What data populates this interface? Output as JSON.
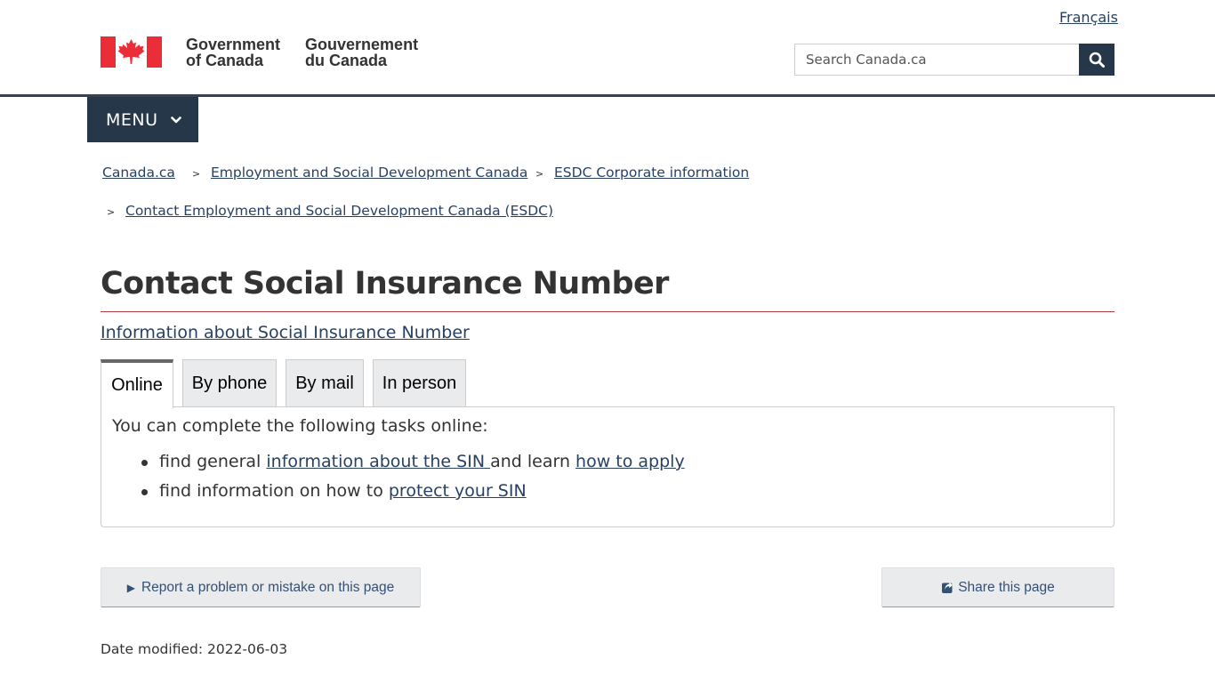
{
  "header": {
    "language_toggle": "Français",
    "gov_en_line1": "Government",
    "gov_en_line2": "of Canada",
    "gov_fr_line1": "Gouvernement",
    "gov_fr_line2": "du Canada",
    "search_placeholder": "Search Canada.ca",
    "search_icon": "search-icon",
    "brand_colors": {
      "flag_red": "#eb2d37",
      "nav_dark": "#26374a",
      "link": "#284162",
      "title_rule": "#af3c43"
    }
  },
  "menu": {
    "label": "MENU",
    "icon": "chevron-down-icon"
  },
  "breadcrumbs": [
    {
      "label": "Canada.ca"
    },
    {
      "label": "Employment and Social Development Canada"
    },
    {
      "label": "ESDC Corporate information"
    },
    {
      "label": "Contact Employment and Social Development Canada (ESDC)"
    }
  ],
  "breadcrumb_separator": ">",
  "page": {
    "title": "Contact Social Insurance Number",
    "info_link": "Information about Social Insurance Number"
  },
  "tabs": [
    {
      "label": "Online",
      "active": true
    },
    {
      "label": "By phone",
      "active": false
    },
    {
      "label": "By mail",
      "active": false
    },
    {
      "label": "In person",
      "active": false
    }
  ],
  "panel": {
    "intro": "You can complete the following tasks online:",
    "item1_prefix": "find general ",
    "item1_link1": "information about the SIN ",
    "item1_middle": "and learn ",
    "item1_link2": "how to apply",
    "item2_prefix": "find information on how to ",
    "item2_link": "protect your SIN"
  },
  "footer_actions": {
    "report_label": "Report a problem or mistake on this page",
    "report_icon": "triangle-right-icon",
    "share_label": "Share this page",
    "share_icon": "share-icon"
  },
  "date_modified": "Date modified: 2022-06-03"
}
